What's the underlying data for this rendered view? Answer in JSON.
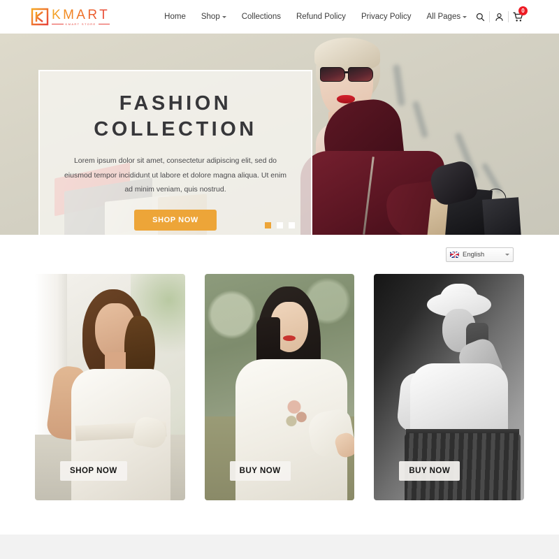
{
  "header": {
    "logo": {
      "name": "KMART",
      "tagline": "KMART STORE"
    },
    "nav": [
      {
        "label": "Home",
        "has_dropdown": false
      },
      {
        "label": "Shop",
        "has_dropdown": true
      },
      {
        "label": "Collections",
        "has_dropdown": false
      },
      {
        "label": "Refund Policy",
        "has_dropdown": false
      },
      {
        "label": "Privacy Policy",
        "has_dropdown": false
      },
      {
        "label": "All Pages",
        "has_dropdown": true
      }
    ],
    "icons": {
      "search": "search-icon",
      "account": "user-icon",
      "cart": "cart-icon"
    },
    "cart_count": "0"
  },
  "hero": {
    "title_line1": "FASHION",
    "title_line2": "COLLECTION",
    "description": "Lorem ipsum dolor sit amet, consectetur adipiscing elit, sed do eiusmod tempor incididunt ut labore et dolore magna aliqua. Ut enim ad minim veniam, quis nostrud.",
    "cta_label": "SHOP NOW",
    "cta_color": "#EDA538",
    "slides": [
      {
        "active": true
      },
      {
        "active": false
      },
      {
        "active": false
      }
    ]
  },
  "language": {
    "selected": "English",
    "flag": "uk-flag-icon"
  },
  "cards": [
    {
      "button_label": "SHOP NOW",
      "alt": "woman in white dress"
    },
    {
      "button_label": "BUY NOW",
      "alt": "woman in white ao dai"
    },
    {
      "button_label": "BUY NOW",
      "alt": "woman with white hat grayscale"
    }
  ]
}
